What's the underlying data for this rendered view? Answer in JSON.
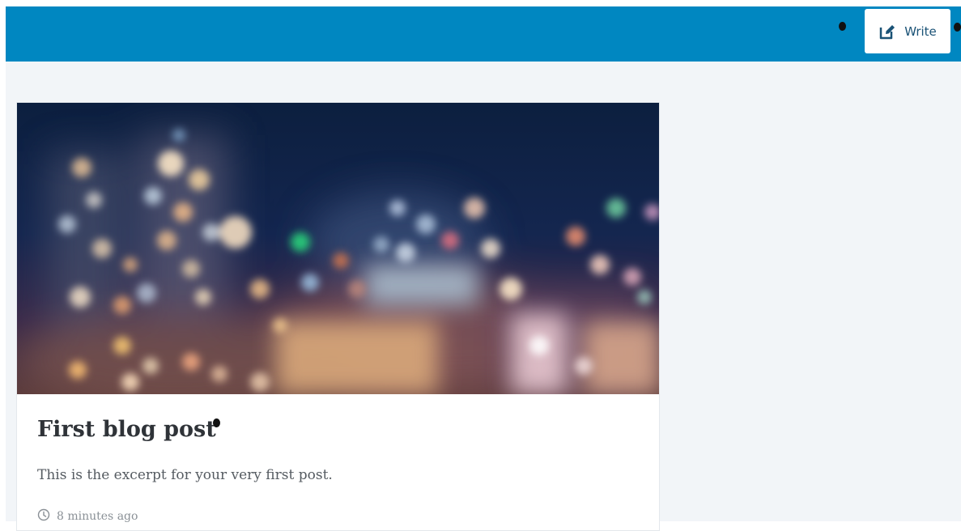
{
  "header": {
    "write_label": "Write",
    "write_icon": "edit-square-icon",
    "bar_color": "#0087c1"
  },
  "post": {
    "title": "First blog post",
    "excerpt": "This is the excerpt for your very first post.",
    "time_icon": "clock-icon",
    "time_ago": "8 minutes ago"
  }
}
